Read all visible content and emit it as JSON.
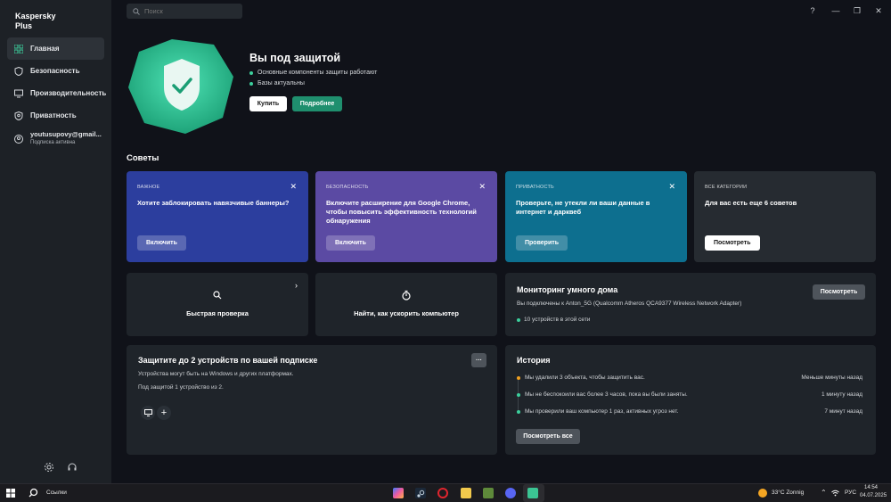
{
  "app": {
    "brand": "Kaspersky Plus"
  },
  "search": {
    "placeholder": "Поиск"
  },
  "window": {
    "help": "?",
    "minimize": "—",
    "restore": "❐",
    "close": "✕"
  },
  "sidebar": {
    "items": [
      {
        "label": "Главная",
        "icon": "grid-icon"
      },
      {
        "label": "Безопасность",
        "icon": "shield-icon"
      },
      {
        "label": "Производительность",
        "icon": "monitor-icon"
      },
      {
        "label": "Приватность",
        "icon": "privacy-shield-icon"
      }
    ],
    "account": {
      "email": "youtusupovy@gmail...",
      "status": "Подписка активна"
    }
  },
  "hero": {
    "title": "Вы под защитой",
    "items": [
      "Основные компоненты защиты работают",
      "Базы актуальны"
    ],
    "buy_label": "Купить",
    "details_label": "Подробнее"
  },
  "tips": {
    "title": "Советы",
    "cards": [
      {
        "category": "ВАЖНОЕ",
        "text": "Хотите заблокировать навязчивые баннеры?",
        "button": "Включить",
        "color": "#2c3e9e"
      },
      {
        "category": "БЕЗОПАСНОСТЬ",
        "text": "Включите расширение для Google Chrome, чтобы повысить эффективность технологий обнаружения",
        "button": "Включить",
        "color": "#5b4aa3"
      },
      {
        "category": "ПРИВАТНОСТЬ",
        "text": "Проверьте, не утекли ли ваши данные в интернет и дарквеб",
        "button": "Проверить",
        "color": "#0d6f8f"
      },
      {
        "category": "ВСЕ КАТЕГОРИИ",
        "text": "Для вас есть еще 6 советов",
        "button": "Посмотреть",
        "color": "#262b31"
      }
    ]
  },
  "quick_scan": {
    "label": "Быстрая проверка"
  },
  "speedup": {
    "label": "Найти, как ускорить компьютер"
  },
  "smart_home": {
    "title": "Мониторинг умного дома",
    "button": "Посмотреть",
    "connection": "Вы подключены к Anton_5G (Qualcomm Atheros QCA9377 Wireless Network Adapter)",
    "devices": "10 устройств в этой сети"
  },
  "devices": {
    "title": "Защитите до 2 устройств по вашей подписке",
    "line1": "Устройства могут быть на Windows и других платформах.",
    "line2": "Под защитой 1 устройство из 2.",
    "more": "···",
    "add": "+"
  },
  "history": {
    "title": "История",
    "rows": [
      {
        "text": "Мы удалили 3 объекта, чтобы защитить вас.",
        "time": "Меньше минуты назад",
        "color": "#f0a020"
      },
      {
        "text": "Мы не беспокоили вас более 3 часов, пока вы были заняты.",
        "time": "1 минуту назад",
        "color": "#3ccf9c"
      },
      {
        "text": "Мы проверили ваш компьютер 1 раз, активных угроз нет.",
        "time": "7 минут назад",
        "color": "#3ccf9c"
      }
    ],
    "button": "Посмотреть все"
  },
  "taskbar": {
    "search": "Ссылки",
    "weather": "33°C Zonnig",
    "lang": "РУС",
    "time": "14:54",
    "date": "04.07.2025"
  }
}
